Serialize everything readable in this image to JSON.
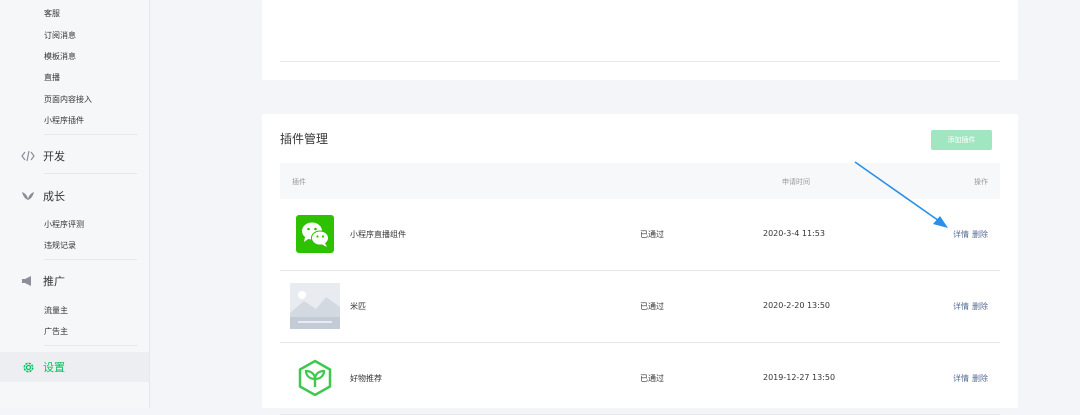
{
  "sidebar": {
    "sub_items_top": [
      "客服",
      "订阅消息",
      "模板消息",
      "直播",
      "页面内容接入",
      "小程序插件"
    ],
    "dev_label": "开发",
    "grow_label": "成长",
    "grow_items": [
      "小程序评测",
      "违规记录"
    ],
    "promo_label": "推广",
    "promo_items": [
      "流量主",
      "广告主"
    ],
    "settings_label": "设置"
  },
  "plugins": {
    "title": "插件管理",
    "add_button": "添加插件",
    "columns": {
      "plugin": "插件",
      "apply_time": "申请时间",
      "actions": "操作"
    },
    "rows": [
      {
        "name": "小程序直播组件",
        "status": "已通过",
        "time": "2020-3-4 11:53",
        "detail": "详情",
        "delete": "删除",
        "icon": "wechat-icon"
      },
      {
        "name": "米匹",
        "status": "已通过",
        "time": "2020-2-20 13:50",
        "detail": "详情",
        "delete": "删除",
        "icon": "image-placeholder-icon"
      },
      {
        "name": "好物推荐",
        "status": "已通过",
        "time": "2019-12-27 13:50",
        "detail": "详情",
        "delete": "删除",
        "icon": "sprout-icon"
      }
    ]
  },
  "colors": {
    "accent": "#07c160",
    "link": "#576b95",
    "annotation_arrow": "#2a8fe6"
  }
}
